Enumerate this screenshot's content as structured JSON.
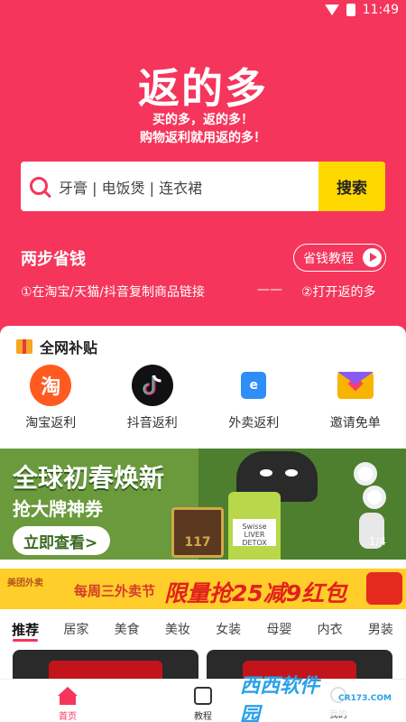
{
  "status_bar": {
    "time": "11:49"
  },
  "header": {
    "title": "返的多",
    "slogan_line1": "买的多，返的多！",
    "slogan_line2": "购物返利就用返的多！"
  },
  "search": {
    "placeholder": "牙膏 | 电饭煲 | 连衣裙",
    "button_label": "搜索"
  },
  "steps": {
    "title": "两步省钱",
    "tutorial_label": "省钱教程",
    "step1": "①在淘宝/天猫/抖音复制商品链接",
    "separator": "——",
    "step2": "②打开返的多"
  },
  "subsidy": {
    "title": "全网补贴",
    "items": [
      {
        "label": "淘宝返利",
        "icon": "淘"
      },
      {
        "label": "抖音返利",
        "icon": "douyin-icon"
      },
      {
        "label": "外卖返利",
        "icon": "e"
      },
      {
        "label": "邀请免单",
        "icon": "invite-envelope-icon"
      }
    ]
  },
  "banner": {
    "title": "全球初春焕新",
    "subtitle": "抢大牌神券",
    "button_label": "立即查看>",
    "indicator": "1/4",
    "product_label": "Swisse LIVER DETOX",
    "jar_label": "117"
  },
  "promo": {
    "logo_text": "美团外卖",
    "text1": "每周三外卖节",
    "text2": "限量抢25减9红包"
  },
  "tabs": [
    "推荐",
    "居家",
    "美食",
    "美妆",
    "女装",
    "母婴",
    "内衣",
    "男装"
  ],
  "nav": {
    "home_label": "首页",
    "tutorial_label": "教程",
    "me_label": "我的"
  },
  "watermark": {
    "text": "西西软件园",
    "sub": "CR173.COM"
  },
  "colors": {
    "primary": "#f5355b",
    "search_button": "#ffd800",
    "banner": "#6a9a3c",
    "promo": "#ffce2a"
  }
}
